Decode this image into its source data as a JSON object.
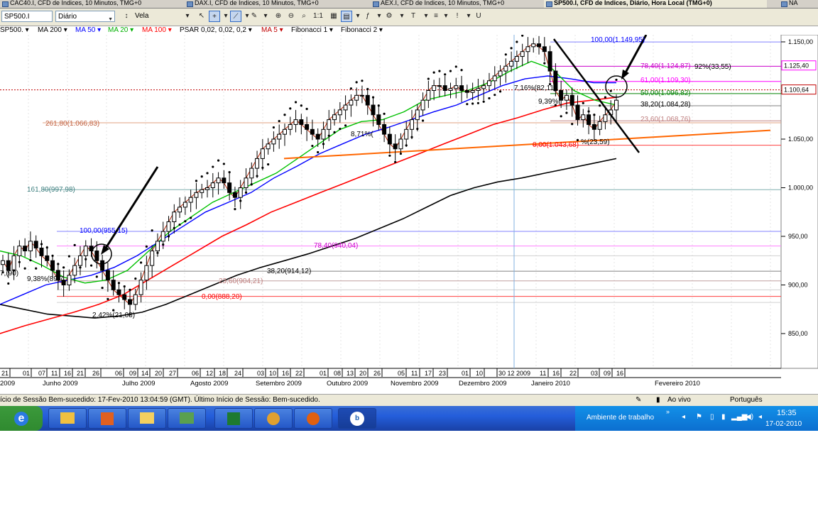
{
  "tabs": [
    {
      "label": "CAC40.I, CFD de Índices, 10 Minutos, TMG+0",
      "active": false
    },
    {
      "label": "DAX.I, CFD de Índices, 10 Minutos, TMG+0",
      "active": false
    },
    {
      "label": "AEX.I, CFD de Índices, 10 Minutos, TMG+0",
      "active": false
    },
    {
      "label": "SP500.I, CFD de Índices, Diário, Hora Local (TMG+0)",
      "active": true
    },
    {
      "label": "NA",
      "active": false
    }
  ],
  "toolbar": {
    "symbol": "SP500.I",
    "period": "Diário",
    "chart_type": "Vela",
    "zoom_label": "1:1"
  },
  "indicators": [
    {
      "label": "SP500.",
      "color": "#000000"
    },
    {
      "label": "MA 200",
      "color": "#000000"
    },
    {
      "label": "MA 50",
      "color": "#0000ff"
    },
    {
      "label": "MA 20",
      "color": "#00b000"
    },
    {
      "label": "MA 100",
      "color": "#ff0000"
    },
    {
      "label": "PSAR 0,02, 0,02, 0,2",
      "color": "#000000"
    },
    {
      "label": "MA 5",
      "color": "#c00000"
    },
    {
      "label": "Fibonacci 1",
      "color": "#000000"
    },
    {
      "label": "Fibonacci 2",
      "color": "#000000"
    }
  ],
  "chart_data": {
    "type": "candlestick",
    "y_ticks": [
      "1.150,00",
      "1.100,00",
      "1.050,00",
      "1.000,00",
      "950,00",
      "900,00",
      "850,00"
    ],
    "price_flags": [
      {
        "label": "1.125,40",
        "color": "#ff00ff"
      },
      {
        "label": "1.100,64",
        "color": "#c00000"
      }
    ],
    "x_days": [
      "21",
      "01",
      "07",
      "11",
      "16",
      "21",
      "26",
      "06",
      "09",
      "14",
      "20",
      "27",
      "06",
      "12",
      "18",
      "24",
      "03",
      "10",
      "16",
      "22",
      "01",
      "08",
      "13",
      "20",
      "26",
      "05",
      "11",
      "17",
      "23",
      "01",
      "10",
      "30 12 2009",
      "11",
      "16",
      "22",
      "03",
      "09",
      "16"
    ],
    "x_months": [
      "2009",
      "Junho 2009",
      "Julho 2009",
      "Agosto 2009",
      "Setembro 2009",
      "Outubro 2009",
      "Novembro 2009",
      "Dezembro 2009",
      "Janeiro 2010",
      "Fevereiro 2010"
    ],
    "fib_right": [
      {
        "label": "100,00(1.149,95)",
        "color": "#0000ff"
      },
      {
        "label": "78,40(1.124,87)",
        "color": "#cc00cc"
      },
      {
        "label": "92%(33,55)",
        "color": "#000000"
      },
      {
        "label": "61,00(1.109,30)",
        "color": "#ff00ff"
      },
      {
        "label": "50,00(1.096,82)",
        "color": "#008000"
      },
      {
        "label": "38,20(1.084,28)",
        "color": "#000000"
      },
      {
        "label": "23,60(1.068,76)",
        "color": "#c08080"
      },
      {
        "label": "0,00(1.043,68)",
        "color": "#ff0000"
      },
      {
        "label": "7,16%(82,11)",
        "color": "#000000"
      },
      {
        "label": "9,39%(",
        "color": "#000000"
      },
      {
        "label": "%(23,59)",
        "color": "#000000"
      },
      {
        "label": "8,71%(",
        "color": "#000000"
      }
    ],
    "fib_left": [
      {
        "label": "261,80(1.066,83)",
        "color": "#c06040"
      },
      {
        "label": "161,80(997,98)",
        "color": "#408080"
      },
      {
        "label": "100,00(955,15)",
        "color": "#0000ff"
      },
      {
        "label": "78,40(940,04)",
        "color": "#cc00cc"
      },
      {
        "label": "38,20(914,12)",
        "color": "#000000"
      },
      {
        "label": "23,60(904,21)",
        "color": "#c08080"
      },
      {
        "label": "0,00(888,20)",
        "color": "#ff0000"
      },
      {
        "label": "9,38%(89,7",
        "color": "#000000"
      },
      {
        "label": "2,42%(21,08)",
        "color": "#000000"
      },
      {
        "label": "7,(90)",
        "color": "#000000"
      }
    ],
    "close": [
      925,
      915,
      930,
      940,
      935,
      945,
      938,
      930,
      925,
      915,
      905,
      900,
      910,
      920,
      930,
      940,
      935,
      925,
      915,
      905,
      895,
      890,
      885,
      880,
      890,
      905,
      920,
      935,
      945,
      955,
      965,
      975,
      980,
      985,
      990,
      995,
      998,
      1000,
      1005,
      1010,
      1005,
      995,
      990,
      1000,
      1010,
      1020,
      1030,
      1040,
      1045,
      1050,
      1055,
      1060,
      1065,
      1070,
      1065,
      1060,
      1055,
      1050,
      1060,
      1070,
      1075,
      1080,
      1085,
      1090,
      1095,
      1095,
      1085,
      1075,
      1065,
      1055,
      1045,
      1040,
      1050,
      1060,
      1070,
      1080,
      1090,
      1100,
      1105,
      1105,
      1100,
      1102,
      1105,
      1100,
      1098,
      1100,
      1102,
      1105,
      1110,
      1115,
      1120,
      1125,
      1130,
      1135,
      1140,
      1145,
      1148,
      1145,
      1140,
      1120,
      1100,
      1090,
      1095,
      1085,
      1070,
      1075,
      1065,
      1060,
      1068,
      1075,
      1080,
      1090
    ],
    "ma200": [
      880,
      875,
      870,
      868,
      866,
      868,
      872,
      880,
      890,
      900,
      910,
      918,
      925,
      932,
      940,
      948,
      958,
      968,
      980,
      992,
      1000,
      1006,
      1010,
      1015,
      1020,
      1025,
      1030
    ],
    "ma100": [
      850,
      858,
      865,
      872,
      880,
      890,
      905,
      920,
      935,
      950,
      962,
      975,
      985,
      995,
      1005,
      1015,
      1025,
      1035,
      1045,
      1055,
      1065,
      1072,
      1080,
      1087,
      1090,
      1093
    ],
    "ma50": [
      880,
      890,
      900,
      905,
      910,
      918,
      930,
      945,
      960,
      975,
      985,
      995,
      1010,
      1022,
      1035,
      1045,
      1055,
      1062,
      1070,
      1078,
      1085,
      1095,
      1105,
      1112,
      1115,
      1112,
      1108,
      1108
    ],
    "ma20": [
      935,
      930,
      920,
      908,
      902,
      905,
      915,
      935,
      955,
      970,
      985,
      995,
      1005,
      1015,
      1030,
      1045,
      1060,
      1068,
      1070,
      1078,
      1090,
      1095,
      1100,
      1108,
      1120,
      1130,
      1122,
      1100,
      1090,
      1085
    ]
  },
  "status": {
    "text": "ício de Sessão Bem-sucedido: 17-Fev-2010 13:04:59 (GMT). Último Início de Sessão: Bem-sucedido.",
    "live": "Ao vivo",
    "language": "Português"
  },
  "taskbar": {
    "desktop_label": "Ambiente de trabalho",
    "time": "15:35",
    "date": "17-02-2010"
  }
}
